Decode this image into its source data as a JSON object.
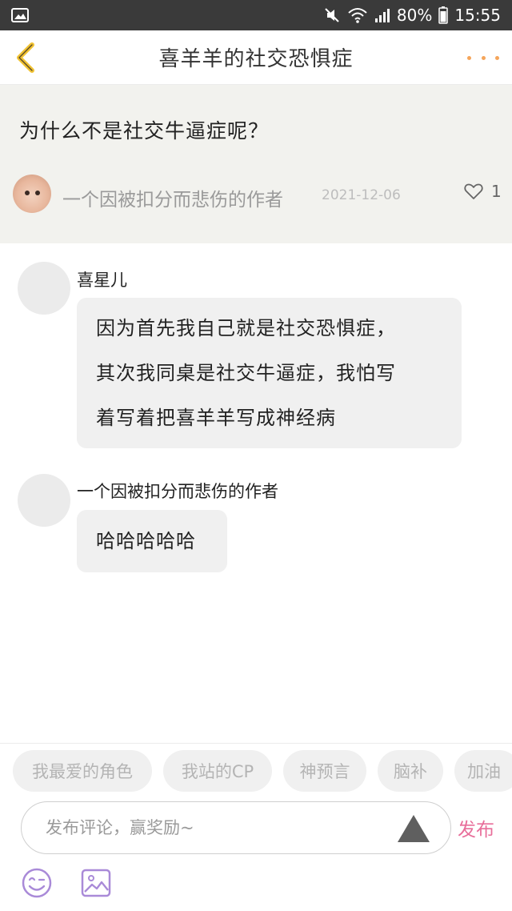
{
  "status_bar": {
    "battery_percent": "80%",
    "time": "15:55",
    "icons": [
      "image-notification-icon",
      "mute-icon",
      "wifi-icon",
      "signal-icon",
      "battery-icon"
    ]
  },
  "header": {
    "title": "喜羊羊的社交恐惧症",
    "accent_color": "#f5a55a"
  },
  "topic": {
    "question": "为什么不是社交牛逼症呢？",
    "author": "一个因被扣分而悲伤的作者",
    "date": "2021-12-06",
    "likes": "1"
  },
  "messages": [
    {
      "name": "喜星儿",
      "lines": [
        "因为首先我自己就是社交恐惧症，",
        "其次我同桌是社交牛逼症，我怕写",
        "着写着把喜羊羊写成神经病"
      ]
    },
    {
      "name": "一个因被扣分而悲伤的作者",
      "lines": [
        "哈哈哈哈哈"
      ]
    }
  ],
  "tags": [
    "我最爱的角色",
    "我站的CP",
    "神预言",
    "脑补",
    "加油"
  ],
  "comment": {
    "placeholder": "发布评论，赢奖励~",
    "publish_label": "发布",
    "publish_color": "#e86e9a"
  }
}
